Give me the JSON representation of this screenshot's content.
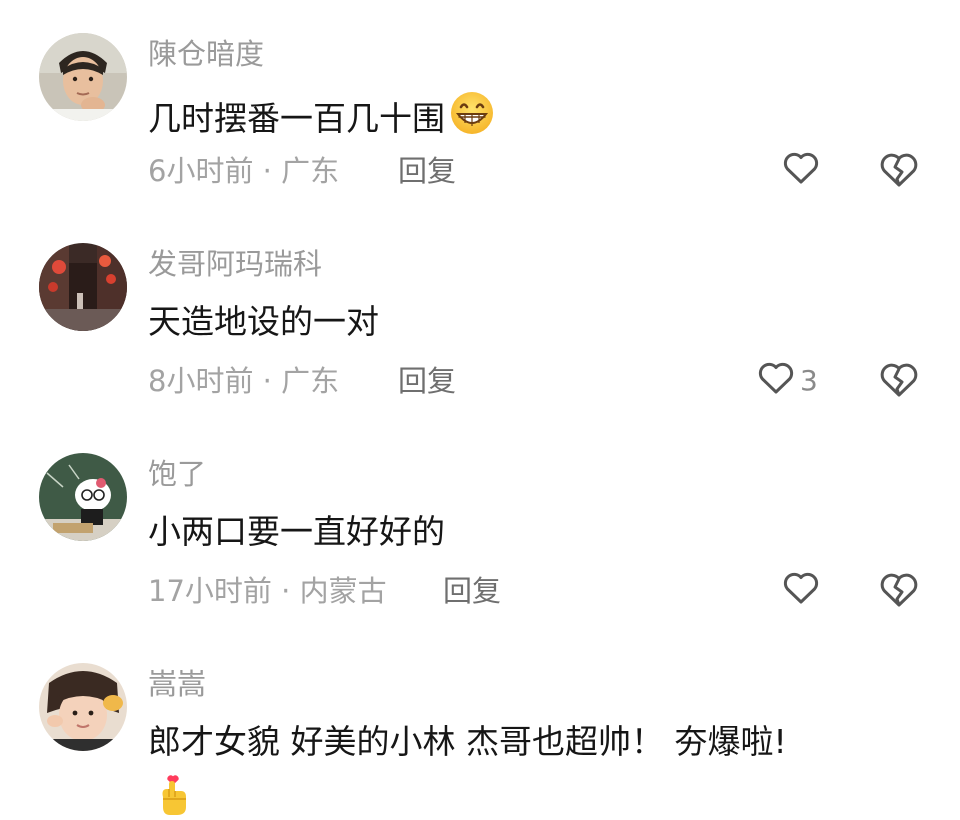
{
  "comments": [
    {
      "username": "陳仓暗度",
      "text": "几时摆番一百几十围",
      "emoji": "grinning-face",
      "time": "6小时前",
      "location": "广东",
      "reply": "回复",
      "likes": ""
    },
    {
      "username": "发哥阿玛瑞科",
      "text": "天造地设的一对",
      "time": "8小时前",
      "location": "广东",
      "reply": "回复",
      "likes": "3"
    },
    {
      "username": "饱了",
      "text": "小两口要一直好好的",
      "time": "17小时前",
      "location": "内蒙古",
      "reply": "回复",
      "likes": ""
    },
    {
      "username": "嵩嵩",
      "text": "郎才女貌 好美的小林 杰哥也超帅！ 夯爆啦!",
      "emoji": "hand-with-index-finger-and-thumb-crossed"
    }
  ],
  "separator": "·",
  "colors": {
    "username": "#9a9a9a",
    "text": "#161616",
    "meta": "#a3a3a3",
    "reply": "#6f6f6f",
    "icon": "#555555"
  }
}
